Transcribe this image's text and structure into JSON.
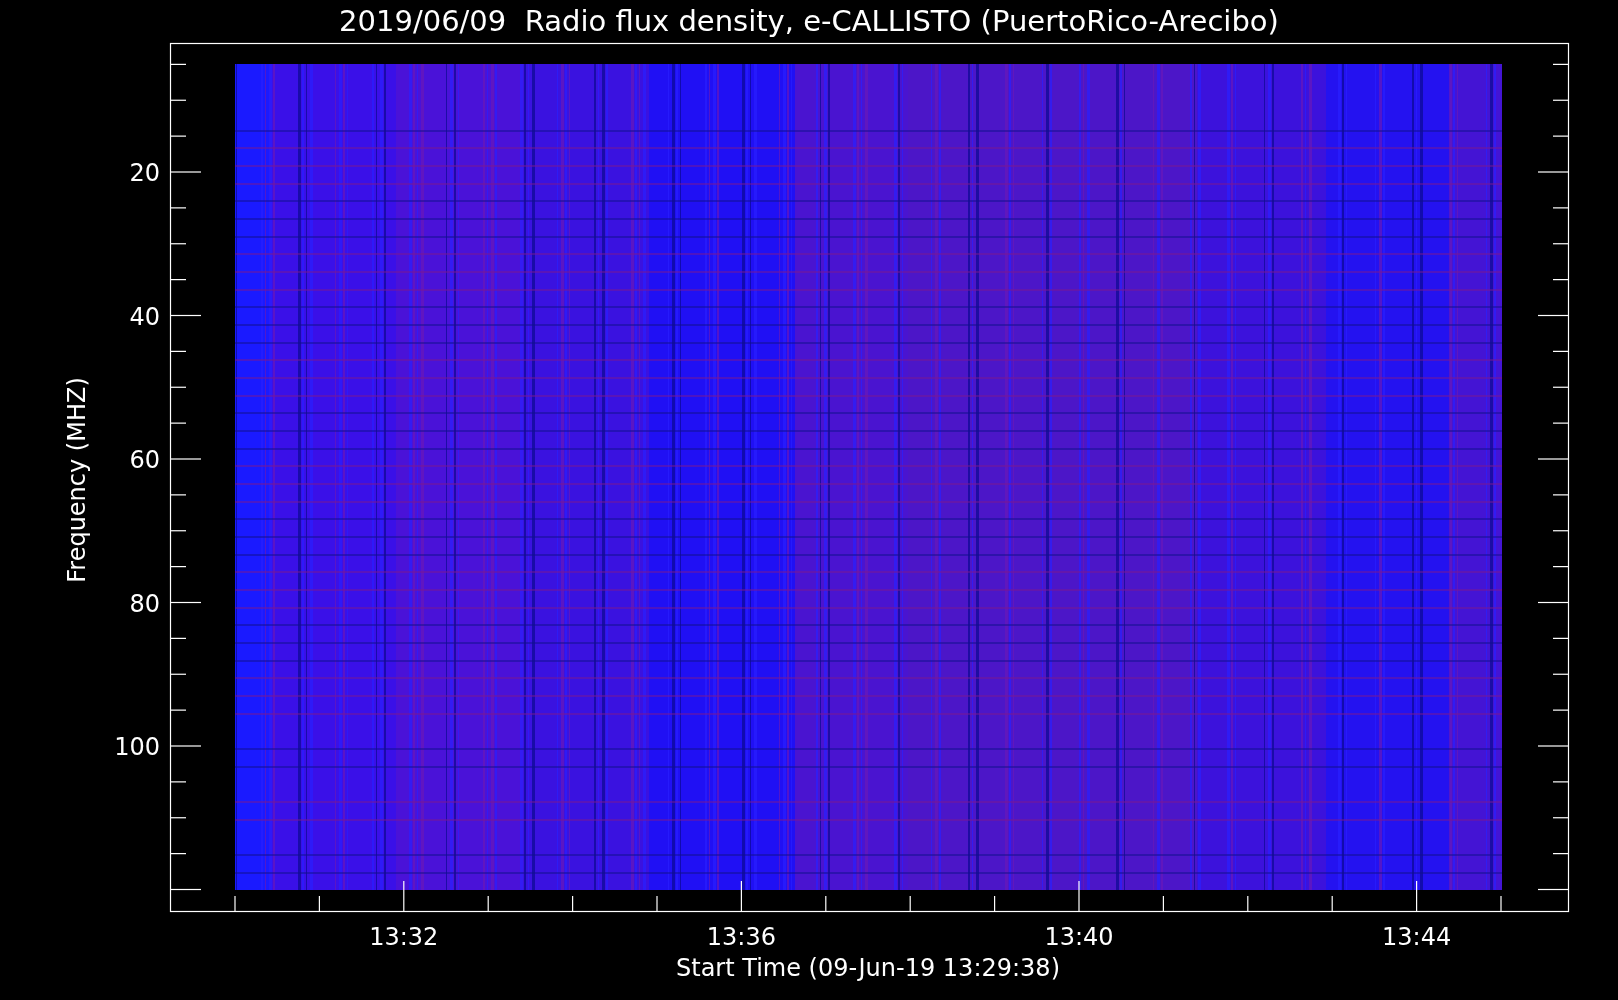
{
  "plot": {
    "title": "2019/06/09  Radio flux density, e-CALLISTO (PuertoRico-Arecibo)",
    "ylabel": "Frequency (MHZ)",
    "xlabel": "Start Time (09-Jun-19 13:29:38)",
    "y_tick_labels": [
      "20",
      "40",
      "60",
      "80",
      "100"
    ],
    "x_tick_labels": [
      "13:32",
      "13:36",
      "13:40",
      "13:44"
    ]
  }
}
